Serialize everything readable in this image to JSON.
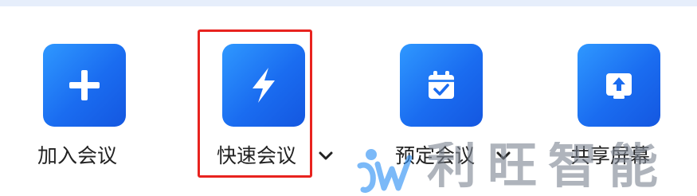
{
  "toolbar": {
    "join": {
      "label": "加入会议",
      "icon": "plus-icon"
    },
    "quick": {
      "label": "快速会议",
      "icon": "lightning-icon",
      "has_dropdown": true
    },
    "schedule": {
      "label": "预定会议",
      "icon": "calendar-check-icon",
      "has_dropdown": true
    },
    "share": {
      "label": "共享屏幕",
      "icon": "screen-share-icon"
    }
  },
  "highlight": {
    "target": "quick",
    "color": "#e8231f"
  },
  "watermark": {
    "text": "利旺智能"
  },
  "colors": {
    "tile_gradient_start": "#2f98ff",
    "tile_gradient_end": "#1457e0",
    "label_text": "#222222",
    "highlight_border": "#e8231f"
  }
}
